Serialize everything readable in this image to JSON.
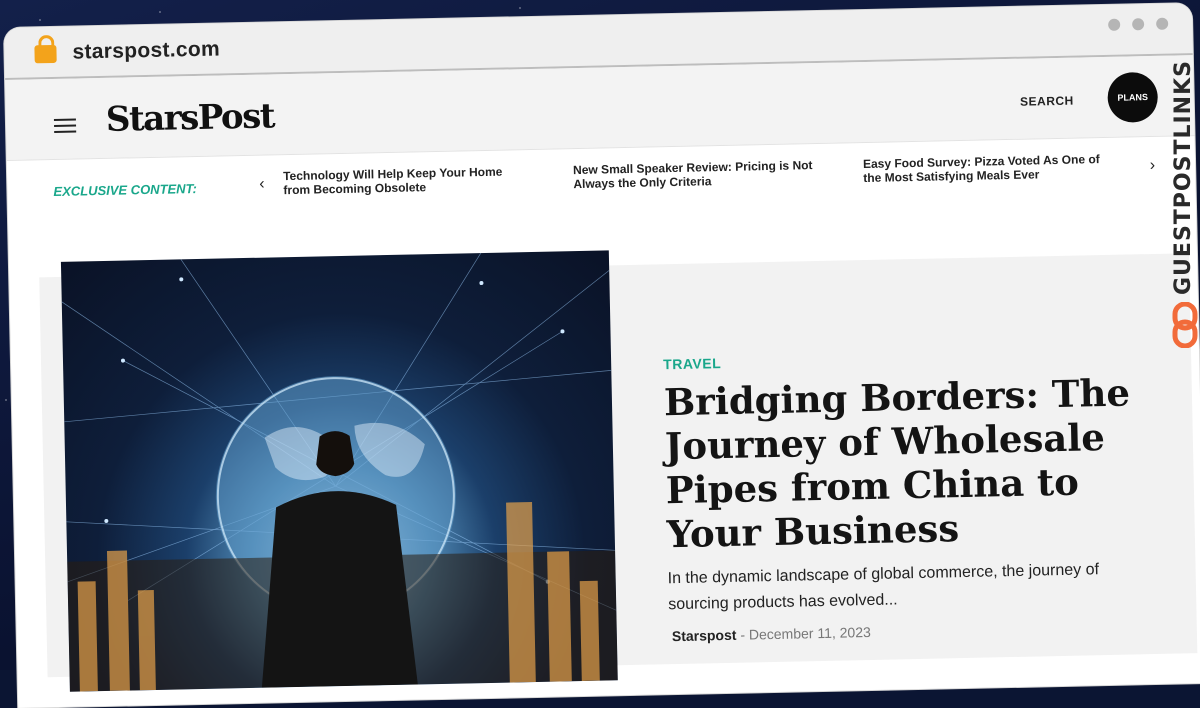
{
  "browser": {
    "url": "starspost.com"
  },
  "header": {
    "logo": "StarsPost",
    "search_label": "SEARCH",
    "plans_label": "PLANS"
  },
  "ticker": {
    "label": "EXCLUSIVE CONTENT:",
    "items": [
      "Technology Will Help Keep Your Home from Becoming Obsolete",
      "New Small Speaker Review: Pricing is Not Always the Only Criteria",
      "Easy Food Survey: Pizza Voted As One of the Most Satisfying Meals Ever"
    ]
  },
  "featured": {
    "category": "TRAVEL",
    "title": "Bridging Borders: The Journey of Wholesale Pipes from China to Your Business",
    "excerpt": "In the dynamic landscape of global commerce, the journey of sourcing products has evolved...",
    "author": "Starspost",
    "separator": "-",
    "date": "December 11, 2023"
  },
  "watermark": {
    "text": "GUESTPOSTLINKS"
  },
  "colors": {
    "accent": "#1aa78b",
    "watermark_orange": "#f26b3a"
  },
  "icons": [
    "lock-icon",
    "menu-icon",
    "chevron-left-icon",
    "chevron-right-icon",
    "chain-link-icon"
  ]
}
